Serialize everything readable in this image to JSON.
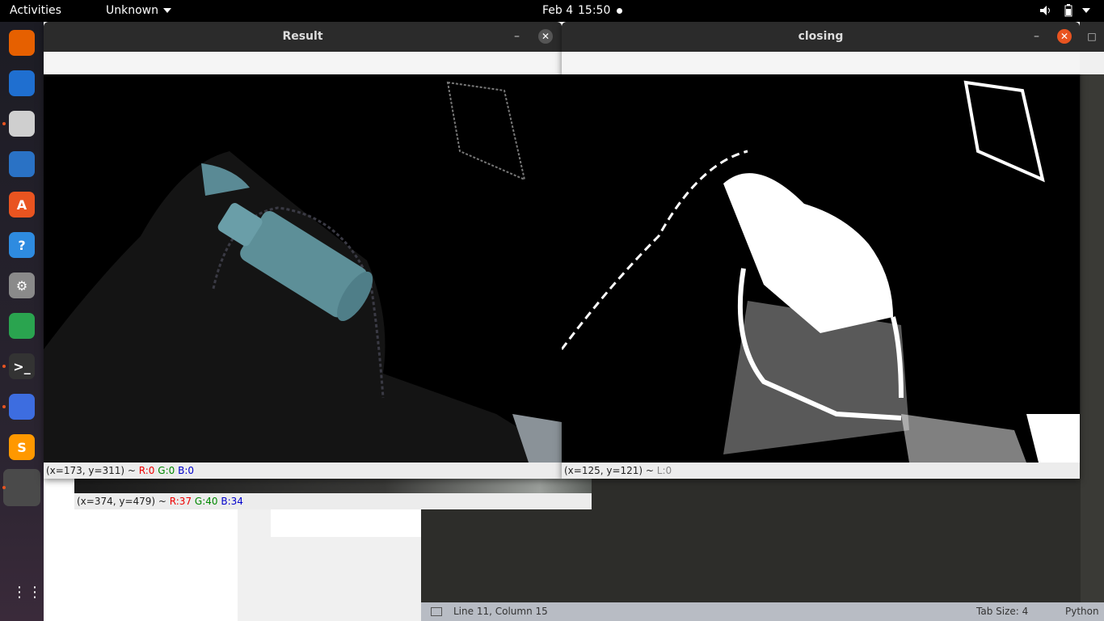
{
  "topbar": {
    "activities": "Activities",
    "app_menu": "Unknown",
    "date": "Feb 4",
    "time": "15:50"
  },
  "dock": {
    "items": [
      {
        "name": "firefox",
        "label": "",
        "color": "#e66000"
      },
      {
        "name": "thunderbird",
        "label": "",
        "color": "#1f6fd0"
      },
      {
        "name": "files",
        "label": "",
        "color": "#cfcfcf"
      },
      {
        "name": "libreoffice-writer",
        "label": "",
        "color": "#2a72c5"
      },
      {
        "name": "software-center",
        "label": "A",
        "color": "#e95420"
      },
      {
        "name": "help",
        "label": "?",
        "color": "#2e8be0"
      },
      {
        "name": "settings",
        "label": "⚙",
        "color": "#8a8a8a"
      },
      {
        "name": "chrome",
        "label": "",
        "color": "#2aa44f"
      },
      {
        "name": "terminal",
        "label": ">_",
        "color": "#333333"
      },
      {
        "name": "screenshot",
        "label": "",
        "color": "#3d6de0"
      },
      {
        "name": "sublime-text",
        "label": "S",
        "color": "#ff9800"
      },
      {
        "name": "active-app",
        "label": "",
        "color": "#4a4a4a"
      }
    ],
    "apps_grid": "⋮⋮⋮"
  },
  "windows": {
    "result": {
      "title": "Result",
      "minimize": "–",
      "close": "✕",
      "status_coords": "(x=173, y=311) ~ ",
      "r": "R:0",
      "g": "G:0",
      "b": "B:0"
    },
    "closing": {
      "title": "closing",
      "minimize": "–",
      "close": "✕",
      "status_coords": "(x=125, y=121) ~ ",
      "l": "L:0"
    },
    "behind": {
      "status_coords": "(x=374, y=479) ~ ",
      "r": "R:37",
      "g": "G:40",
      "b": "B:34"
    }
  },
  "editor_status": {
    "position": "Line 11, Column 15",
    "tab_size": "Tab Size: 4",
    "language": "Python"
  }
}
